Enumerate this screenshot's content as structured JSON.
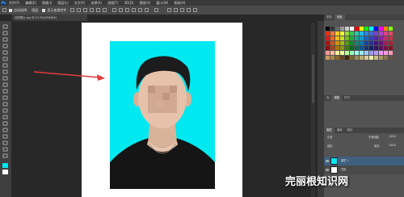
{
  "app": {
    "logo": "Ps"
  },
  "menubar": {
    "items": [
      "文件(F)",
      "编辑(E)",
      "图像(I)",
      "图层(L)",
      "文字(Y)",
      "选择(S)",
      "滤镜(T)",
      "3D(D)",
      "视图(V)",
      "窗口(W)",
      "帮助(H)"
    ]
  },
  "options": {
    "tool_label": "自动选择:",
    "target": "图层",
    "show_transform": "显示变换控件"
  },
  "document": {
    "tab_title": "月的照片.jpg @ 33.3%(RGB/8#)"
  },
  "panels": {
    "top_tabs": [
      "颜色",
      "色板"
    ],
    "mid_tabs": [
      "库",
      "调整",
      "样式"
    ],
    "layer_tabs": [
      "图层",
      "通道",
      "路径"
    ],
    "blend_mode": "正常",
    "opacity_label": "不透明度:",
    "opacity": "100%",
    "lock_label": "锁定:",
    "fill_label": "填充:",
    "fill": "100%",
    "layers": [
      {
        "name": "图层 1",
        "selected": true
      },
      {
        "name": "背景",
        "selected": false
      }
    ]
  },
  "watermark": {
    "text": "完丽根知识网"
  },
  "colors": {
    "photo_bg": "#00e8f0",
    "arrow": "#e23b3b",
    "selected_layer": "#3f5f7f"
  }
}
